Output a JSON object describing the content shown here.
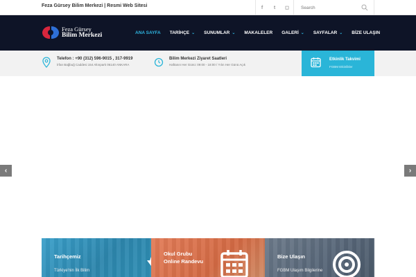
{
  "topbar": {
    "site_title": "Feza Gürsey Bilim Merkezi | Resmi Web Sitesi",
    "social": [
      {
        "icon": "facebook-icon",
        "glyph": "f"
      },
      {
        "icon": "twitter-icon",
        "glyph": "t"
      },
      {
        "icon": "instagram-icon",
        "glyph": "◻"
      }
    ],
    "search_placeholder": "Search"
  },
  "logo": {
    "line1": "Feza Gürsey",
    "line2": "Bilim Merkezi"
  },
  "nav": {
    "items": [
      {
        "label": "ANA SAYFA",
        "active": true,
        "dropdown": false
      },
      {
        "label": "TARİHÇE",
        "active": false,
        "dropdown": true
      },
      {
        "label": "SUNUMLAR",
        "active": false,
        "dropdown": true
      },
      {
        "label": "MAKALELER",
        "active": false,
        "dropdown": false
      },
      {
        "label": "GALERİ",
        "active": false,
        "dropdown": true
      },
      {
        "label": "SAYFALAR",
        "active": false,
        "dropdown": true
      },
      {
        "label": "BİZE ULAŞIN",
        "active": false,
        "dropdown": false
      }
    ],
    "chevron": "⌄"
  },
  "info": {
    "phone": {
      "title": "Telefon : +90 (312) 596-9015 , 317-9919",
      "sub": "İrfan Bağbuğ Caddesi 154 Altınpark 06140 ANKARA"
    },
    "hours": {
      "title": "Bilim Merkezi Ziyaret Saatleri",
      "sub": "Haftanın Her Günü: 09:00 - 18:00 / Yılın Her Günü Açık"
    },
    "calendar": {
      "title": "Etkinlik Takvimi",
      "sub": "FGBM Etkinlikler"
    }
  },
  "slider": {
    "prev": "‹",
    "next": "›"
  },
  "cards": [
    {
      "title": "Tarihçemiz",
      "sub": "Türkiye'nin İlk Bilim",
      "icon": "history-icon"
    },
    {
      "title_line1": "Okul Grubu",
      "title_line2": "Online Randevu",
      "icon": "calendar-icon"
    },
    {
      "title": "Bize Ulaşın",
      "sub": "FGBM Ulaşım Bilgilerine",
      "icon": "target-icon"
    }
  ],
  "colors": {
    "navbar": "#0e1427",
    "accent": "#2fb5e0",
    "calendar_box": "#2ab5d8"
  }
}
